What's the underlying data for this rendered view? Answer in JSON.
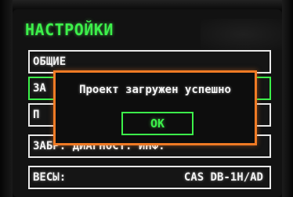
{
  "screen": {
    "title": "НАСТРОЙКИ"
  },
  "menu": {
    "items": [
      {
        "label": "ОБЩИЕ",
        "value": ""
      },
      {
        "label": "ЗА",
        "value": ""
      },
      {
        "label": "П",
        "value": ""
      },
      {
        "label": "ЗАБР. ДИАГНОСТ. ИНФ.",
        "value": ""
      },
      {
        "label": "ВЕСЫ:",
        "value": "CAS DB-1H/AD"
      }
    ]
  },
  "dialog": {
    "message": "Проект загружен успешно",
    "ok_label": "OK"
  },
  "colors": {
    "title": "#3cf04a",
    "selected_border": "#3cf04a",
    "dialog_border": "#f07a24",
    "text": "#f2f2f2",
    "background": "#121212"
  }
}
